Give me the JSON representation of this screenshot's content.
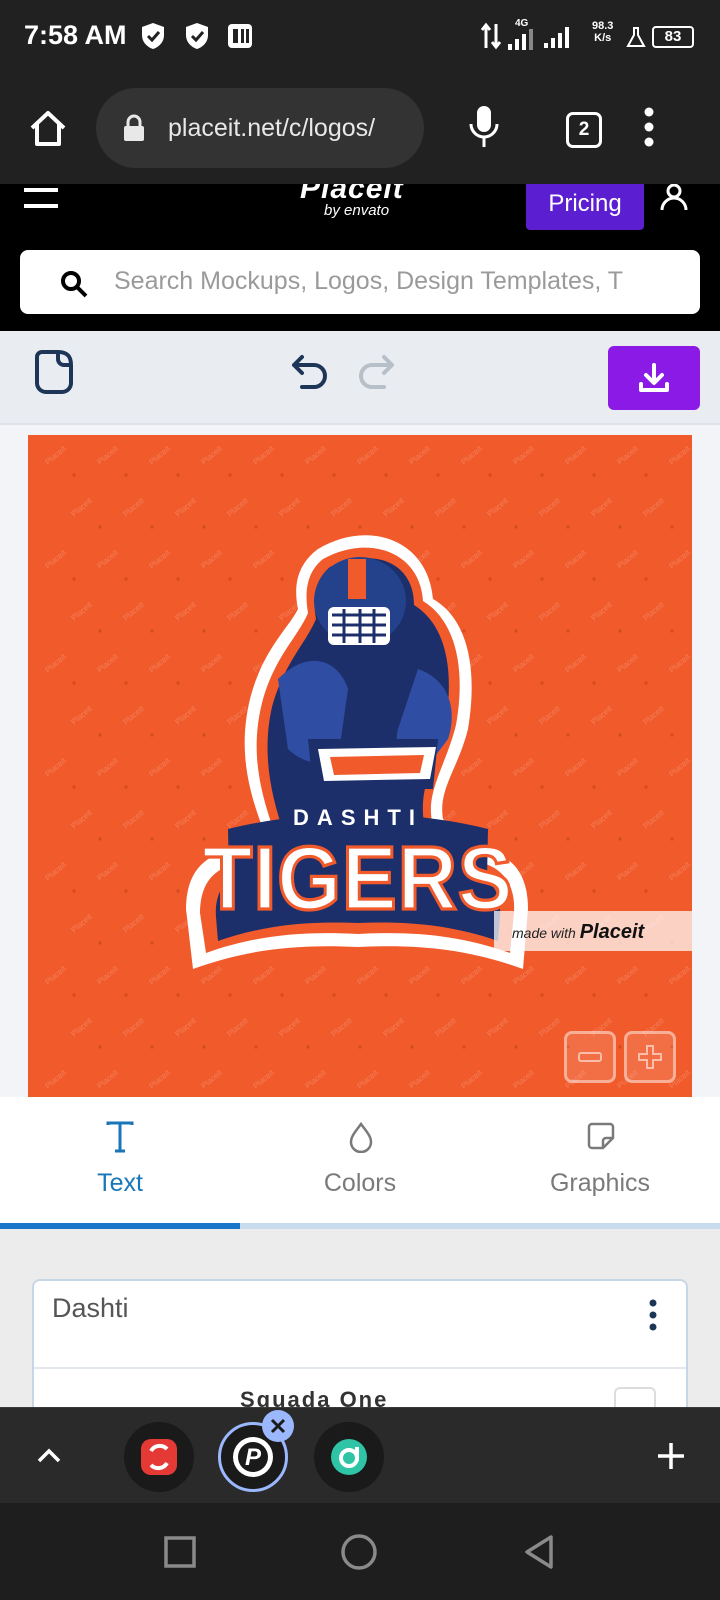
{
  "status_bar": {
    "time": "7:58 AM",
    "network": "4G",
    "speed_value": "98.3",
    "speed_unit": "K/s",
    "battery": "83"
  },
  "browser": {
    "url": "placeit.net/c/logos/",
    "tab_count": "2"
  },
  "site_header": {
    "logo": "Placeit",
    "logo_sub": "by envato",
    "pricing_label": "Pricing",
    "search_placeholder": "Search Mockups, Logos, Design Templates, T"
  },
  "canvas": {
    "background_color": "#f15a2b",
    "logo_top_text": "DASHTI",
    "logo_main_text": "TIGERS",
    "watermark_prefix": "made with",
    "watermark_brand": "Placeit",
    "pattern_text": "Placeit"
  },
  "tabs": [
    {
      "label": "Text",
      "icon": "text-icon",
      "active": true
    },
    {
      "label": "Colors",
      "icon": "drop-icon",
      "active": false
    },
    {
      "label": "Graphics",
      "icon": "sticker-icon",
      "active": false
    }
  ],
  "text_panel": {
    "text_value": "Dashti",
    "font_name": "Squada One"
  },
  "colors": {
    "accent_purple": "#8b1ae6",
    "pricing_purple": "#5b1fd1",
    "tab_active_blue": "#1976b8",
    "logo_navy": "#1c2f6b",
    "logo_orange": "#f15a2b"
  }
}
